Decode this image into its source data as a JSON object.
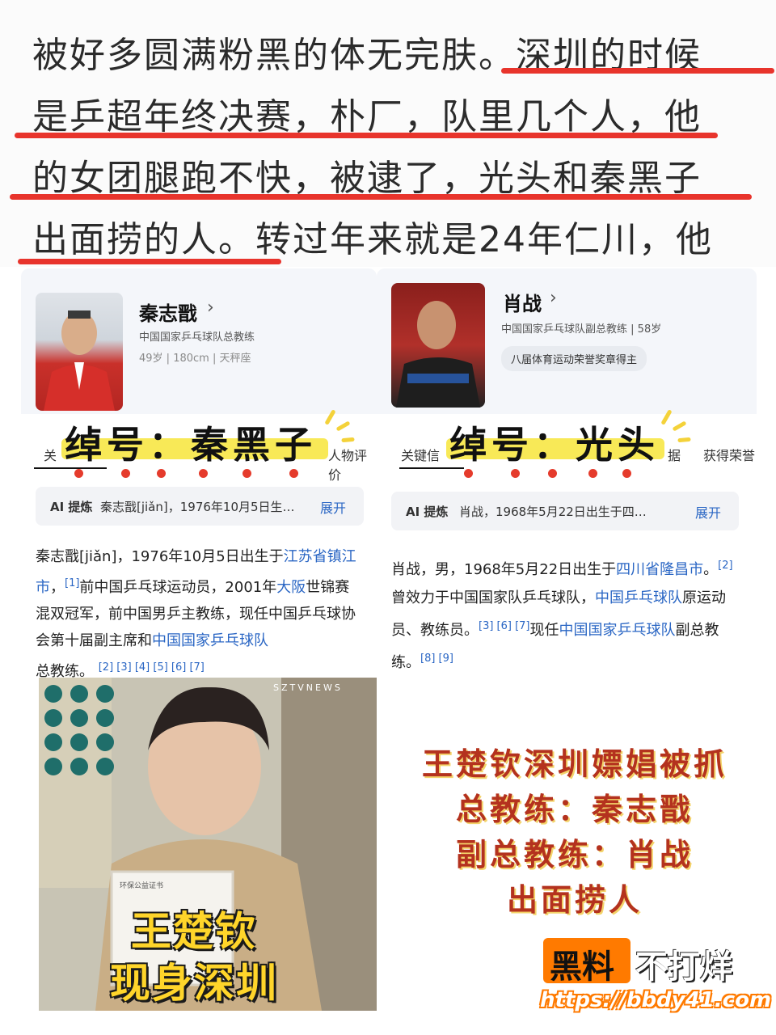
{
  "top_text": {
    "lines": [
      "被好多圆满粉黑的体无完肤。深圳的时候",
      "是乒超年终决赛，朴厂，队里几个人，他",
      "的女团腿跑不快，被逮了，光头和秦黑子",
      "出面捞的人。转过年来就是24年仁川，他"
    ]
  },
  "left_card": {
    "name": "秦志戬",
    "title": "中国国家乒乓球队总教练",
    "meta": [
      "49岁",
      "180cm",
      "天秤座"
    ],
    "nickname": "绰号：秦黑子",
    "tabs": [
      "关",
      "人物评价"
    ],
    "ai_label": "AI 提炼",
    "ai_text": "秦志戬[jiǎn]，1976年10月5日生…",
    "ai_more": "展开",
    "para": {
      "p1": "秦志戬[jiǎn]，1976年10月5日出生于",
      "l1": "江苏省镇江市",
      "r1": "[1]",
      "p2": "前中国乒乓球运动员，2001年",
      "l2": "大阪",
      "p3": "世锦赛混双冠军，前中国男乒主教练，现任中国乒乓球协会第十届副主席和",
      "l3": "中国国家乒乓球队",
      "p4": "总教练。",
      "r2": "[2] [3] [4] [5] [6] [7]"
    }
  },
  "right_card": {
    "name": "肖战",
    "title": "中国国家乒乓球队副总教练",
    "age": "58岁",
    "honor": "八届体育运动荣誉奖章得主",
    "nickname": "绰号：光头",
    "tabs": [
      "关键信",
      "据",
      "获得荣誉"
    ],
    "ai_label": "AI 提炼",
    "ai_text": "肖战，1968年5月22日出生于四…",
    "ai_more": "展开",
    "para": {
      "p1": "肖战，男，1968年5月22日出生于",
      "l1": "四川省隆昌市",
      "r1": "[2]",
      "p2": "曾效力于中国国家队乒乓球队，",
      "l2": "中国乒乓球队",
      "p3": "原运动员、教练员。",
      "r2": "[3] [6] [7]",
      "p4": "现任",
      "l3": "中国国家乒乓球队",
      "p5": "副总教练。",
      "r3": "[8] [9]"
    }
  },
  "video": {
    "watermark": "SZTVNEWS",
    "line1": "王楚钦",
    "line2": "现身深圳",
    "certificate": "环保公益证书"
  },
  "caption": [
    "王楚钦深圳嫖娼被抓",
    "总教练：秦志戬",
    "副总教练：肖战",
    "出面捞人"
  ],
  "brand": {
    "box_text": "黑料",
    "rest": "不打烊",
    "url": "https://bbdy41.com"
  }
}
